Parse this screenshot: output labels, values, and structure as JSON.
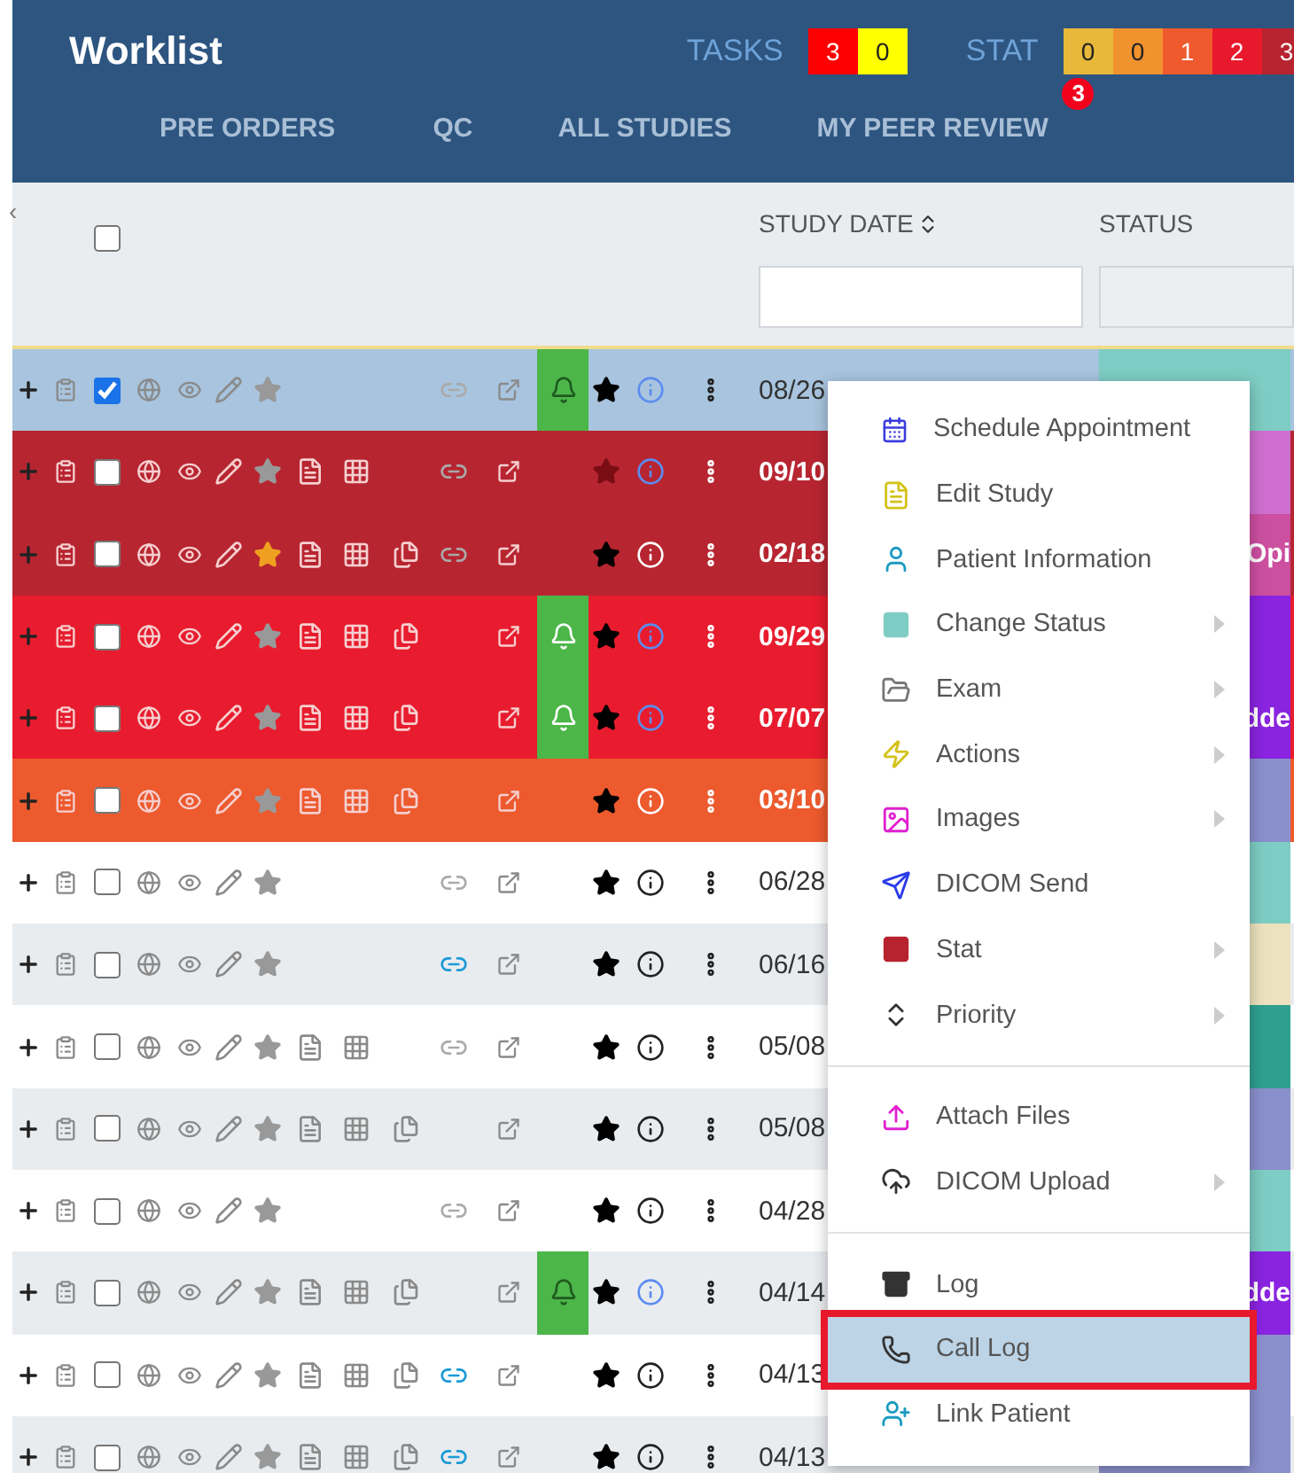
{
  "header": {
    "title": "Worklist",
    "tasks": {
      "label": "TASKS",
      "counts": [
        {
          "value": "3",
          "color": "#ff0000"
        },
        {
          "value": "0",
          "color": "#ffff00"
        }
      ]
    },
    "stat": {
      "label": "STAT",
      "counts": [
        {
          "value": "0",
          "color": "#e8b83a"
        },
        {
          "value": "0",
          "color": "#f0922e"
        },
        {
          "value": "1",
          "color": "#ee5a2e"
        },
        {
          "value": "2",
          "color": "#e8192c"
        },
        {
          "value": "3",
          "color": "#b7232f"
        }
      ]
    },
    "tabs": [
      {
        "label": "PRE ORDERS",
        "selected": false
      },
      {
        "label": "QC",
        "selected": false
      },
      {
        "label": "ALL STUDIES",
        "selected": false
      },
      {
        "label": "MY PEER REVIEW",
        "selected": false,
        "badge": "3"
      }
    ]
  },
  "table": {
    "collapse": "‹",
    "select_all": {
      "checked": false
    },
    "columns": [
      {
        "label": "STUDY DATE",
        "sortable": true
      },
      {
        "label": "STATUS",
        "sortable": false
      }
    ],
    "rows": [
      {
        "color": "#a8c4de",
        "checked": true,
        "starred": false,
        "report": false,
        "attachment": false,
        "linked": true,
        "link_active": false,
        "bell": true,
        "flag_muted": false,
        "info_alert": true,
        "date": "08/26",
        "status": {
          "color": "#7ecdc4"
        }
      },
      {
        "color": "#b72531",
        "checked": false,
        "starred": false,
        "report": true,
        "attachment": false,
        "linked": true,
        "link_active": false,
        "bell": false,
        "flag_muted": true,
        "info_alert": true,
        "date": "09/10",
        "status": {
          "color": "#cf6fd0"
        }
      },
      {
        "color": "#b72531",
        "checked": false,
        "starred": true,
        "report": true,
        "attachment": true,
        "linked": true,
        "link_active": false,
        "bell": false,
        "flag_muted": false,
        "info_alert": false,
        "date": "02/18",
        "status": {
          "color": "#cc4fa0",
          "text": "Opi"
        }
      },
      {
        "color": "#e81c2e",
        "checked": false,
        "starred": false,
        "report": true,
        "attachment": true,
        "linked": false,
        "link_active": false,
        "bell": true,
        "flag_muted": false,
        "info_alert": true,
        "date": "09/29",
        "status": {
          "color": "#8a24e0"
        }
      },
      {
        "color": "#e81c2e",
        "checked": false,
        "starred": false,
        "report": true,
        "attachment": true,
        "linked": false,
        "link_active": false,
        "bell": true,
        "flag_muted": false,
        "info_alert": true,
        "date": "07/07",
        "status": {
          "color": "#8a24e0",
          "text": "dde"
        }
      },
      {
        "color": "#ec5a2e",
        "checked": false,
        "starred": false,
        "report": true,
        "attachment": true,
        "linked": false,
        "link_active": false,
        "bell": false,
        "flag_muted": false,
        "info_alert": false,
        "date": "03/10",
        "status": {
          "color": "#8a90cc"
        }
      },
      {
        "color": "#ffffff",
        "checked": false,
        "starred": false,
        "report": false,
        "attachment": false,
        "linked": true,
        "link_active": false,
        "bell": false,
        "flag_muted": false,
        "info_alert": false,
        "date": "06/28",
        "status": {
          "color": "#7ecdc4"
        }
      },
      {
        "color": "#e9ecef",
        "checked": false,
        "starred": false,
        "report": false,
        "attachment": false,
        "linked": true,
        "link_active": true,
        "bell": false,
        "flag_muted": false,
        "info_alert": false,
        "date": "06/16",
        "status": {
          "color": "#ece2bd"
        }
      },
      {
        "color": "#ffffff",
        "checked": false,
        "starred": false,
        "report": true,
        "attachment": false,
        "linked": true,
        "link_active": false,
        "bell": false,
        "flag_muted": false,
        "info_alert": false,
        "date": "05/08",
        "status": {
          "color": "#2fa090"
        }
      },
      {
        "color": "#e9ecef",
        "checked": false,
        "starred": false,
        "report": true,
        "attachment": true,
        "linked": false,
        "link_active": false,
        "bell": false,
        "flag_muted": false,
        "info_alert": false,
        "date": "05/08",
        "status": {
          "color": "#8a90cc"
        }
      },
      {
        "color": "#ffffff",
        "checked": false,
        "starred": false,
        "report": false,
        "attachment": false,
        "linked": true,
        "link_active": false,
        "bell": false,
        "flag_muted": false,
        "info_alert": false,
        "date": "04/28",
        "status": {
          "color": "#7ecdc4"
        }
      },
      {
        "color": "#e9ecef",
        "checked": false,
        "starred": false,
        "report": true,
        "attachment": true,
        "linked": false,
        "link_active": false,
        "bell": true,
        "flag_muted": false,
        "info_alert": true,
        "date": "04/14",
        "status": {
          "color": "#8a24e0",
          "text": "dde"
        }
      },
      {
        "color": "#ffffff",
        "checked": false,
        "starred": false,
        "report": true,
        "attachment": true,
        "linked": true,
        "link_active": true,
        "bell": false,
        "flag_muted": false,
        "info_alert": false,
        "date": "04/13",
        "status": {
          "color": "#8a90cc"
        }
      },
      {
        "color": "#e9ecef",
        "checked": false,
        "starred": false,
        "report": true,
        "attachment": true,
        "linked": true,
        "link_active": true,
        "bell": false,
        "flag_muted": false,
        "info_alert": false,
        "date": "04/13",
        "status": {
          "color": "#8a90cc"
        }
      }
    ]
  },
  "context_menu": {
    "groups": [
      [
        {
          "label": "Schedule Appointment",
          "submenu": false,
          "selected": false
        },
        {
          "label": "Edit Study",
          "submenu": false,
          "selected": false
        },
        {
          "label": "Patient Information",
          "submenu": false,
          "selected": false
        },
        {
          "label": "Change Status",
          "submenu": true,
          "selected": false
        },
        {
          "label": "Exam",
          "submenu": true,
          "selected": false
        },
        {
          "label": "Actions",
          "submenu": true,
          "selected": false
        },
        {
          "label": "Images",
          "submenu": true,
          "selected": false
        },
        {
          "label": "DICOM Send",
          "submenu": false,
          "selected": false
        },
        {
          "label": "Stat",
          "submenu": true,
          "selected": false
        },
        {
          "label": "Priority",
          "submenu": true,
          "selected": false
        }
      ],
      [
        {
          "label": "Attach Files",
          "submenu": false,
          "selected": false
        },
        {
          "label": "DICOM Upload",
          "submenu": true,
          "selected": false
        }
      ],
      [
        {
          "label": "Log",
          "submenu": false,
          "selected": false
        },
        {
          "label": "Call Log",
          "submenu": false,
          "selected": true
        },
        {
          "label": "Link Patient",
          "submenu": false,
          "selected": false
        }
      ]
    ]
  }
}
